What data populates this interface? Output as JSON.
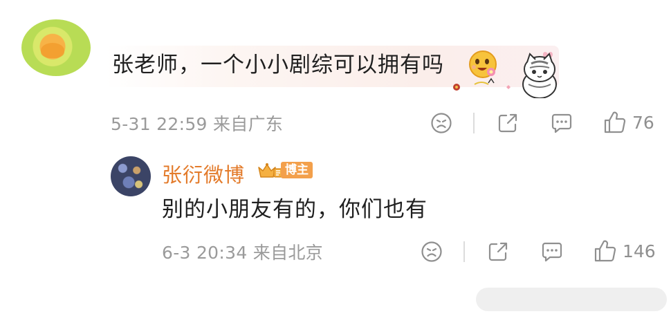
{
  "comment": {
    "text": "张老师，一个小小剧综可以拥有吗",
    "meta": "5-31 22:59 来自广东",
    "like_count": "76"
  },
  "reply": {
    "author": "张衍微博",
    "badge": "博主",
    "text": "别的小朋友有的，你们也有",
    "meta": "6-3 20:34 来自北京",
    "like_count": "146"
  },
  "icons": {
    "dislike": "dislike-face-icon",
    "share": "share-icon",
    "comment": "comment-icon",
    "like": "thumbs-up-icon"
  },
  "colors": {
    "author_name": "#e37b2b",
    "badge_bg": "#f3a04b",
    "meta_text": "#9a9a9a"
  }
}
